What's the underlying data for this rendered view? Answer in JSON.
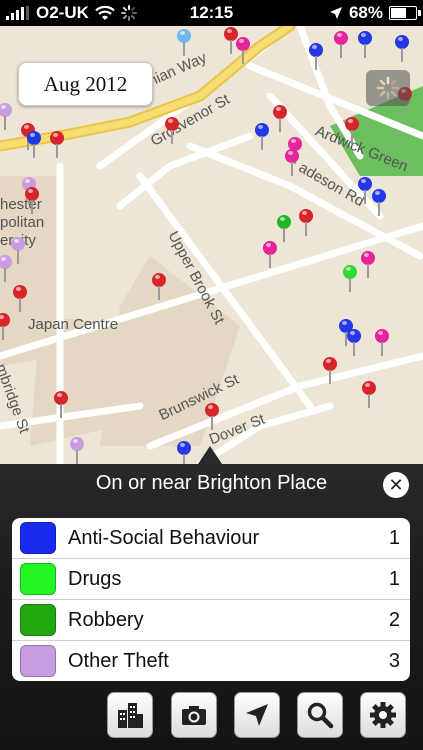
{
  "status_bar": {
    "carrier": "O2-UK",
    "time": "12:15",
    "battery": "68%",
    "battery_level": 0.68,
    "icons": [
      "signal-bars-icon",
      "wifi-icon",
      "activity-spinner-icon",
      "location-arrow-icon",
      "battery-icon"
    ]
  },
  "map": {
    "date_label": "Aug 2012",
    "refresh_icon": "loading-spinner-icon",
    "street_labels": [
      "Mancunian Way",
      "Grosvenor St",
      "Ardwick Green",
      "adeson Rd",
      "Upper Brook St",
      "Japan Centre",
      "Brunswick St",
      "Dover St",
      "mbridge St",
      "hester",
      "politan",
      "ersity"
    ],
    "pin_colors": {
      "red": "#d8252c",
      "blue": "#2438e8",
      "pink": "#e8249a",
      "green": "#22b52a",
      "lime": "#2fdc2f",
      "lavender": "#c99ce0",
      "light_blue": "#6fb8ee"
    }
  },
  "info_panel": {
    "title": "On or near Brighton Place",
    "close_icon": "close-icon",
    "crimes": [
      {
        "label": "Anti-Social Behaviour",
        "count": "1",
        "color": "#1a2bf0"
      },
      {
        "label": "Drugs",
        "count": "1",
        "color": "#22f522"
      },
      {
        "label": "Robbery",
        "count": "2",
        "color": "#21a70f"
      },
      {
        "label": "Other Theft",
        "count": "3",
        "color": "#c69de3"
      }
    ]
  },
  "toolbar": {
    "buttons": [
      {
        "icon": "buildings-icon"
      },
      {
        "icon": "camera-icon"
      },
      {
        "icon": "location-arrow-icon"
      },
      {
        "icon": "search-icon"
      },
      {
        "icon": "gear-icon"
      }
    ]
  }
}
